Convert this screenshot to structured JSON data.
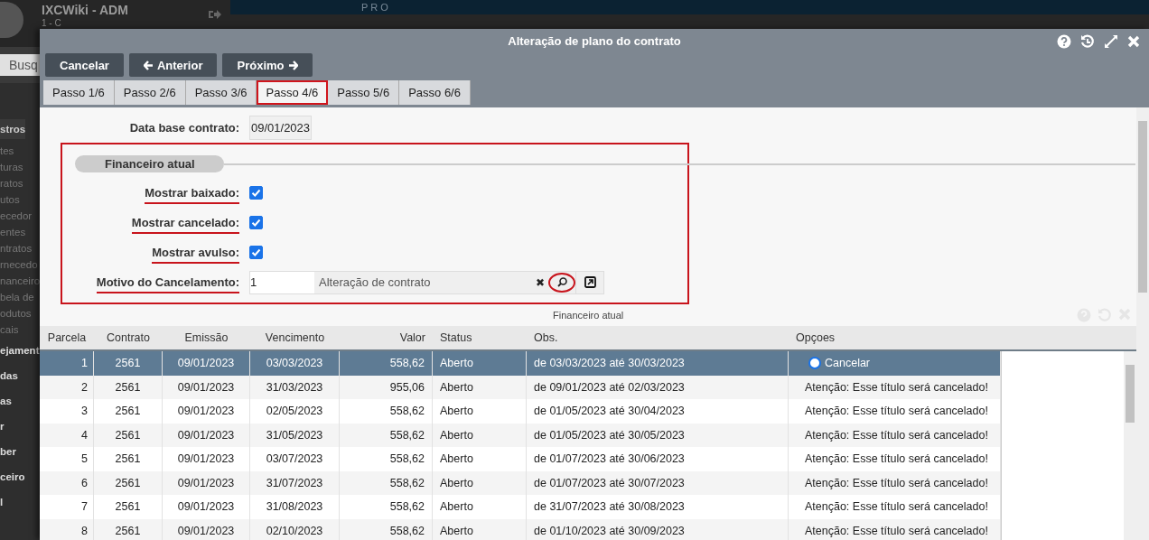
{
  "background_app": {
    "title": "IXCWiki - ADM",
    "subtitle": "1 - C",
    "search_button": "Busq",
    "top_text": "PRO",
    "sidebar": [
      {
        "label": "stros",
        "kind": "group"
      },
      {
        "label": "tes",
        "kind": "link"
      },
      {
        "label": "turas",
        "kind": "link"
      },
      {
        "label": "ratos",
        "kind": "link"
      },
      {
        "label": "utos",
        "kind": "link"
      },
      {
        "label": "ecedor",
        "kind": "link"
      },
      {
        "label": "entes",
        "kind": "link"
      },
      {
        "label": "ntratos",
        "kind": "link"
      },
      {
        "label": "rnecedo",
        "kind": "link"
      },
      {
        "label": "nanceiro",
        "kind": "link"
      },
      {
        "label": "bela de",
        "kind": "link"
      },
      {
        "label": "odutos",
        "kind": "link"
      },
      {
        "label": "cais",
        "kind": "link"
      },
      {
        "label": "ejament",
        "kind": "heading"
      },
      {
        "label": "das",
        "kind": "heading"
      },
      {
        "label": "as",
        "kind": "heading"
      },
      {
        "label": "r",
        "kind": "heading"
      },
      {
        "label": "ber",
        "kind": "heading"
      },
      {
        "label": "ceiro",
        "kind": "heading"
      },
      {
        "label": "l",
        "kind": "heading"
      }
    ]
  },
  "window": {
    "title": "Alteração de plano do contrato"
  },
  "buttons": [
    {
      "label": "Cancelar",
      "kind": "plain"
    },
    {
      "label": "Anterior",
      "kind": "back"
    },
    {
      "label": "Próximo",
      "kind": "next"
    }
  ],
  "tabs": [
    {
      "label": "Passo 1/6",
      "selected": false
    },
    {
      "label": "Passo 2/6",
      "selected": false
    },
    {
      "label": "Passo 3/6",
      "selected": false
    },
    {
      "label": "Passo 4/6",
      "selected": true
    },
    {
      "label": "Passo 5/6",
      "selected": false
    },
    {
      "label": "Passo 6/6",
      "selected": false
    }
  ],
  "data_base": {
    "label": "Data base contrato:",
    "value": "09/01/2023"
  },
  "section": {
    "title": "Financeiro atual",
    "highlighted": true,
    "checkboxes": [
      {
        "label": "Mostrar baixado:",
        "checked": true,
        "underlined": true
      },
      {
        "label": "Mostrar cancelado:",
        "checked": true,
        "underlined": true
      },
      {
        "label": "Mostrar avulso:",
        "checked": true,
        "underlined": true
      }
    ],
    "motivo": {
      "label": "Motivo do Cancelamento:",
      "underlined": true,
      "code": "1",
      "description": "Alteração de contrato",
      "clear_icon": "✖",
      "search_circled": true
    }
  },
  "caption": "Financeiro atual",
  "table": {
    "columns": [
      "Parcela",
      "Contrato",
      "Emissão",
      "Vencimento",
      "Valor",
      "Status",
      "Obs.",
      "Opçoes"
    ],
    "rows": [
      {
        "cells": [
          "1",
          "2561",
          "09/01/2023",
          "03/03/2023",
          "558,62",
          "Aberto",
          "de 03/03/2023 até 30/03/2023"
        ],
        "selected": true,
        "option": {
          "kind": "radio",
          "label": "Cancelar",
          "checked": false
        }
      },
      {
        "cells": [
          "2",
          "2561",
          "09/01/2023",
          "31/03/2023",
          "955,06",
          "Aberto",
          "de 09/01/2023 até 02/03/2023"
        ],
        "selected": false,
        "option": {
          "kind": "notice",
          "label": "Atenção: Esse título será cancelado!"
        }
      },
      {
        "cells": [
          "3",
          "2561",
          "09/01/2023",
          "02/05/2023",
          "558,62",
          "Aberto",
          "de 01/05/2023 até 30/04/2023"
        ],
        "selected": false,
        "option": {
          "kind": "notice",
          "label": "Atenção: Esse título será cancelado!"
        }
      },
      {
        "cells": [
          "4",
          "2561",
          "09/01/2023",
          "31/05/2023",
          "558,62",
          "Aberto",
          "de 01/05/2023 até 30/05/2023"
        ],
        "selected": false,
        "option": {
          "kind": "notice",
          "label": "Atenção: Esse título será cancelado!"
        }
      },
      {
        "cells": [
          "5",
          "2561",
          "09/01/2023",
          "03/07/2023",
          "558,62",
          "Aberto",
          "de 01/07/2023 até 30/06/2023"
        ],
        "selected": false,
        "option": {
          "kind": "notice",
          "label": "Atenção: Esse título será cancelado!"
        }
      },
      {
        "cells": [
          "6",
          "2561",
          "09/01/2023",
          "31/07/2023",
          "558,62",
          "Aberto",
          "de 01/07/2023 até 30/07/2023"
        ],
        "selected": false,
        "option": {
          "kind": "notice",
          "label": "Atenção: Esse título será cancelado!"
        }
      },
      {
        "cells": [
          "7",
          "2561",
          "09/01/2023",
          "31/08/2023",
          "558,62",
          "Aberto",
          "de 31/07/2023 até 30/08/2023"
        ],
        "selected": false,
        "option": {
          "kind": "notice",
          "label": "Atenção: Esse título será cancelado!"
        }
      },
      {
        "cells": [
          "8",
          "2561",
          "09/01/2023",
          "02/10/2023",
          "558,62",
          "Aberto",
          "de 01/10/2023 até 30/09/2023"
        ],
        "selected": false,
        "option": {
          "kind": "notice",
          "label": "Atenção: Esse título será cancelado!"
        }
      }
    ]
  }
}
